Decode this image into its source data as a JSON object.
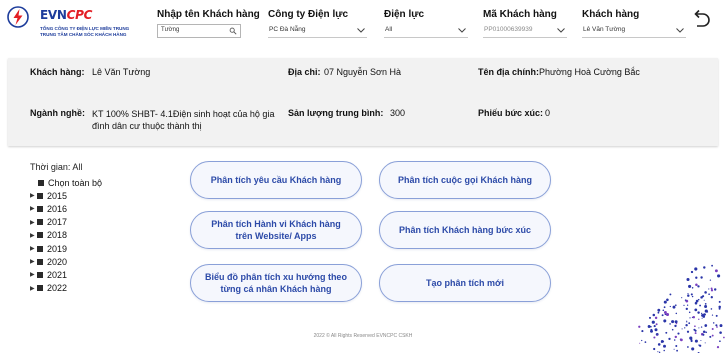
{
  "brand": {
    "name_main": "EVN",
    "name_accent": "CPC",
    "line1": "TỔNG CÔNG TY ĐIỆN LỰC MIỀN TRUNG",
    "line2": "TRUNG TÂM CHĂM SÓC KHÁCH HÀNG",
    "color": "#1d3c9b",
    "accent": "#e31e24"
  },
  "filters": {
    "name_search": {
      "label": "Nhập tên Khách hàng",
      "value": "Tường"
    },
    "company": {
      "label": "Công ty Điện lực",
      "value": "PC Đà Nẵng"
    },
    "branch": {
      "label": "Điện lực",
      "value": "All"
    },
    "customer_code": {
      "label": "Mã Khách hàng",
      "value": "PP01000639939"
    },
    "customer": {
      "label": "Khách hàng",
      "value": "Lê Văn Tường"
    }
  },
  "info": {
    "customer_label": "Khách hàng:",
    "customer_value": "Lê Văn Tường",
    "address_label": "Địa chỉ:",
    "address_value": "07 Nguyễn Sơn Hà",
    "ward_label": "Tên địa chính:",
    "ward_value": "Phường Hoà Cường Bắc",
    "job_label": "Ngành nghề:",
    "job_value": "KT 100% SHBT-  4.1Điện sinh hoạt của hộ gia đình dân cư thuộc thành thị",
    "usage_label": "Sản lượng trung bình:",
    "usage_value": "300",
    "complaint_label": "Phiếu bức xúc:",
    "complaint_value": "0"
  },
  "time_slicer": {
    "title": "Thời gian: All",
    "select_all": "Chọn toàn bộ",
    "years": [
      "2015",
      "2016",
      "2017",
      "2018",
      "2019",
      "2020",
      "2021",
      "2022"
    ]
  },
  "actions": {
    "request_analysis": "Phân tích yêu cầu Khách hàng",
    "call_analysis": "Phân tích cuộc gọi Khách hàng",
    "web_behavior": "Phân tích Hành vi Khách hàng trên Website/ Apps",
    "complaint_analysis": "Phân tích Khách hàng bức xúc",
    "trend_chart": "Biểu đồ phân tích xu hướng theo từng cá nhân Khách hàng",
    "new_analysis": "Tạo phân tích mới"
  },
  "footer": "2022 © All Rights Reserved EVNCPC CSKH",
  "colors": {
    "button_text": "#2c4aa8",
    "button_border": "#8aa0d8",
    "panel_bg": "#f2f2f2"
  }
}
